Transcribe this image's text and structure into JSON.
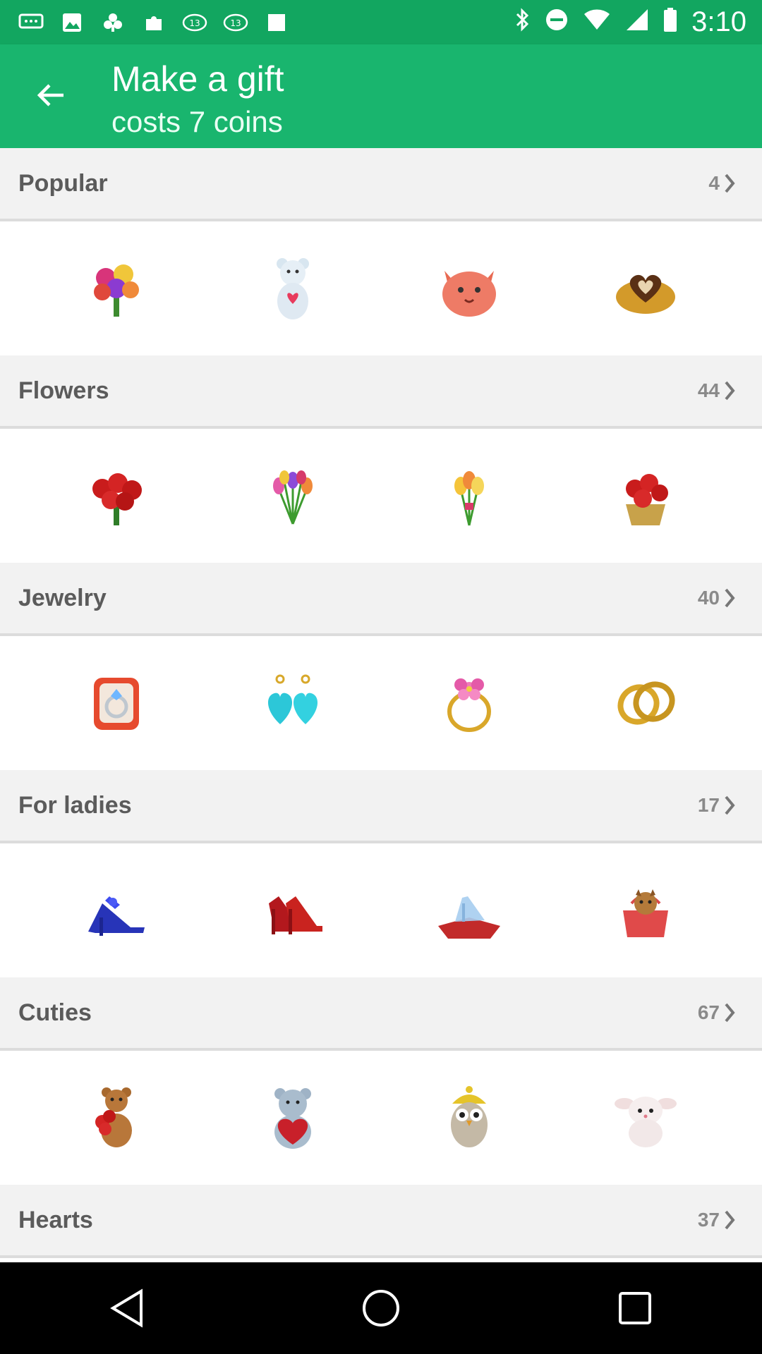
{
  "status_bar": {
    "time": "3:10"
  },
  "header": {
    "title": "Make a gift",
    "subtitle": "costs 7 coins"
  },
  "sections": [
    {
      "title": "Popular",
      "count": "4",
      "gifts": [
        "flower-bouquet-icon",
        "teddy-bear-icon",
        "cat-icon",
        "chocolate-heart-icon"
      ]
    },
    {
      "title": "Flowers",
      "count": "44",
      "gifts": [
        "red-roses-icon",
        "tulips-icon",
        "yellow-tulips-icon",
        "rose-basket-icon"
      ]
    },
    {
      "title": "Jewelry",
      "count": "40",
      "gifts": [
        "ring-box-icon",
        "heart-earrings-icon",
        "flower-ring-icon",
        "wedding-rings-icon"
      ]
    },
    {
      "title": "For ladies",
      "count": "17",
      "gifts": [
        "blue-heels-icon",
        "red-heels-icon",
        "glass-slipper-icon",
        "dog-purse-icon"
      ]
    },
    {
      "title": "Cuties",
      "count": "67",
      "gifts": [
        "bear-with-roses-icon",
        "love-bear-icon",
        "owl-icon",
        "white-creature-icon"
      ]
    },
    {
      "title": "Hearts",
      "count": "37",
      "gifts": []
    }
  ],
  "colors": {
    "status_bar": "#12a660",
    "app_bar": "#19b56e",
    "section_bg": "#f2f2f2"
  }
}
